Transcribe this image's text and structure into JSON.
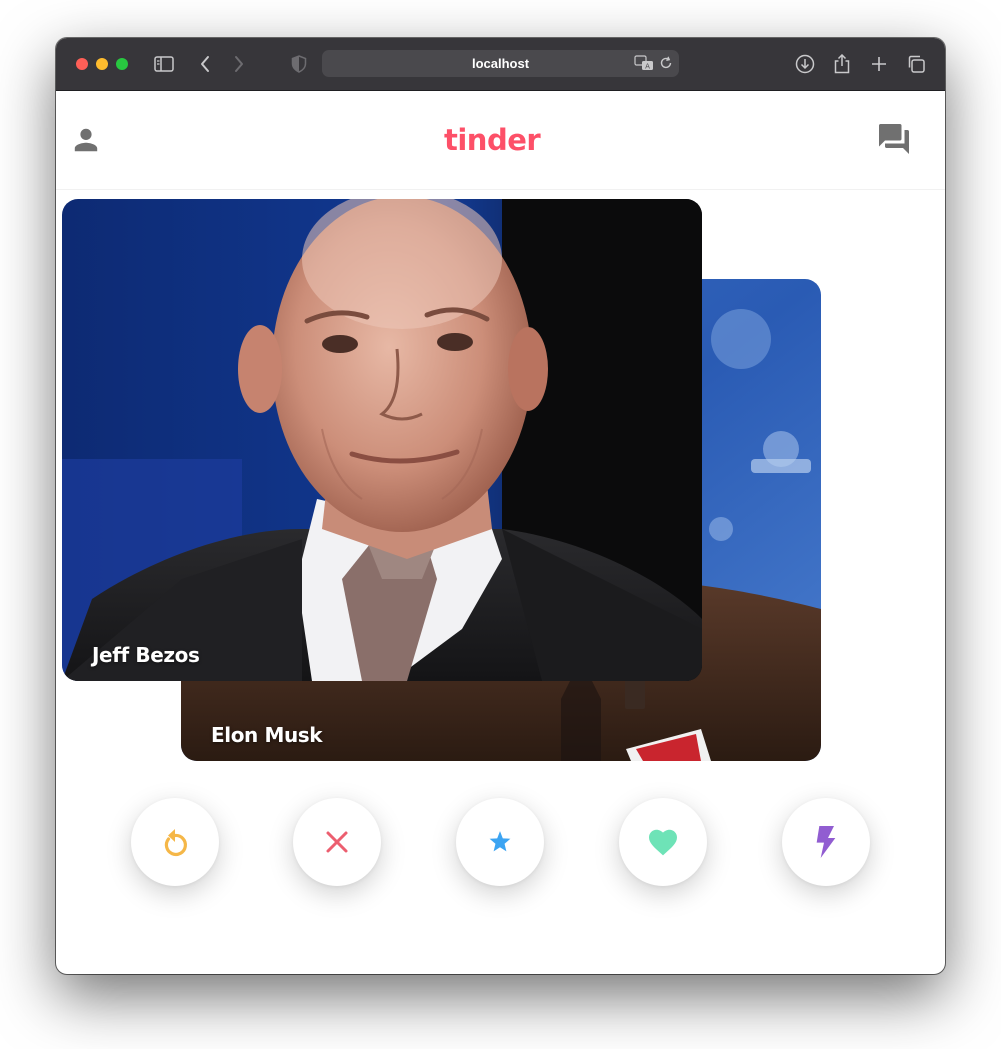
{
  "browser": {
    "url": "localhost",
    "icons": [
      "sidebar-icon",
      "back-icon",
      "forward-icon",
      "shield-icon",
      "translate-icon",
      "reload-icon",
      "download-icon",
      "share-icon",
      "new-tab-icon",
      "tabs-overview-icon"
    ]
  },
  "app": {
    "logo": "tinder",
    "brand_color": "#fd5068",
    "header_icons": [
      "person-icon",
      "chat-icon"
    ]
  },
  "cards": [
    {
      "name": "Jeff Bezos",
      "position": "front"
    },
    {
      "name": "Elon Musk",
      "position": "back"
    }
  ],
  "actions": [
    {
      "name": "rewind",
      "icon": "rewind-icon",
      "color": "#f5b748"
    },
    {
      "name": "nope",
      "icon": "close-icon",
      "color": "#ec5e6f"
    },
    {
      "name": "super-like",
      "icon": "star-icon",
      "color": "#3ca4f2"
    },
    {
      "name": "like",
      "icon": "heart-icon",
      "color": "#6ee3b7"
    },
    {
      "name": "boost",
      "icon": "lightning-icon",
      "color": "#915dd1"
    }
  ]
}
